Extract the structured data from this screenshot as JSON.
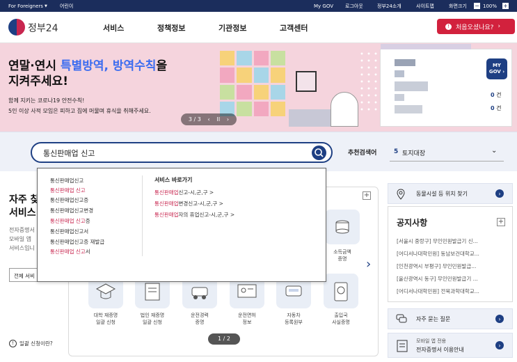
{
  "topbar": {
    "foreigners": "For Foreigners",
    "easy": "어린이",
    "mygov": "My GOV",
    "logout": "로그아웃",
    "intro": "정부24소개",
    "sitemap": "사이트맵",
    "zoom_label": "화면크기",
    "zoom_value": "100%"
  },
  "header": {
    "logo_text": "정부24",
    "menu": [
      "서비스",
      "정책정보",
      "기관정보",
      "고객센터"
    ],
    "first_visit": "처음오셨나요?"
  },
  "banner": {
    "title_line1_a": "연말·연시 ",
    "title_line1_b": "특별방역, 방역수칙",
    "title_line1_c": "을",
    "title_line2": "지켜주세요!",
    "sub1": "함께 지키는 코로나19 안전수칙!",
    "sub2": "5인 이상 사적 모임은 피하고 집에 머물며 휴식을 취해주세요.",
    "pager": "3 / 3",
    "pause": "II"
  },
  "mygov_card": {
    "badge_line1": "MY",
    "badge_line2": "GOV",
    "count1": "0",
    "count1_unit": "건",
    "count2": "0",
    "count2_unit": "건"
  },
  "search": {
    "value": "통신판매업 신고",
    "recommend_label": "추천검색어",
    "recommend_rank": "5",
    "recommend_term": "토지대장"
  },
  "autocomplete": {
    "left": [
      {
        "pre": "통신판매업신고",
        "hl": "",
        "post": ""
      },
      {
        "pre": "",
        "hl": "통신판매업 신고",
        "post": ""
      },
      {
        "pre": "통신판매업신고증",
        "hl": "",
        "post": ""
      },
      {
        "pre": "통신판매업신고변경",
        "hl": "",
        "post": ""
      },
      {
        "pre": "",
        "hl": "통신판매업 신고",
        "post": "증"
      },
      {
        "pre": "통신판매업신고서",
        "hl": "",
        "post": ""
      },
      {
        "pre": "통신판매업신고증 재발급",
        "hl": "",
        "post": ""
      },
      {
        "pre": "",
        "hl": "통신판매업 신고",
        "post": "서"
      }
    ],
    "shortcut_title": "서비스 바로가기",
    "shortcuts": [
      {
        "hl": "통신판매업",
        "post": "신고-시,군,구 >"
      },
      {
        "hl": "통신판매업",
        "post": "변경신고-시,군,구 >"
      },
      {
        "hl": "통신판매업",
        "post": "자의 휴업신고-시,군,구 >"
      }
    ]
  },
  "left_section": {
    "title1": "자주 찾",
    "title2": "서비스",
    "desc1": "전자증명서",
    "desc2": "모바일 앱",
    "desc3": "서비스입니",
    "select_label": "전체 서비",
    "help": "일괄 신청이란?"
  },
  "services": {
    "row2": [
      "대학 재증명\n일괄 신청",
      "법인 재증명\n일괄 신청",
      "운전경력\n증명",
      "운전면허\n정보",
      "자동차\n등록원부",
      "출입국\n사실증명"
    ],
    "partial": "소득금액\n증명",
    "pager": "1 / 2"
  },
  "right": {
    "location": "동물시설 등 위치 찾기",
    "notice_title": "공지사항",
    "notices": [
      "[서울시 중랑구] 무인민원발급기 신...",
      "[어디서나대학민원] 동남보건대학교...",
      "[인천광역시 부평구] 무인민원발급...",
      "[울산광역시 동구] 무인민원발급기 ...",
      "[어디서나대학민원] 전북과학대학교..."
    ],
    "faq": "자주 묻는 질문",
    "mobile1": "모바일 앱 전용",
    "mobile2": "전자증명서 이용안내"
  },
  "colors": {
    "navy": "#1b2d5c",
    "accent": "#d2213d",
    "highlight": "#3b6cf0",
    "banner": "#f5d4dd"
  }
}
